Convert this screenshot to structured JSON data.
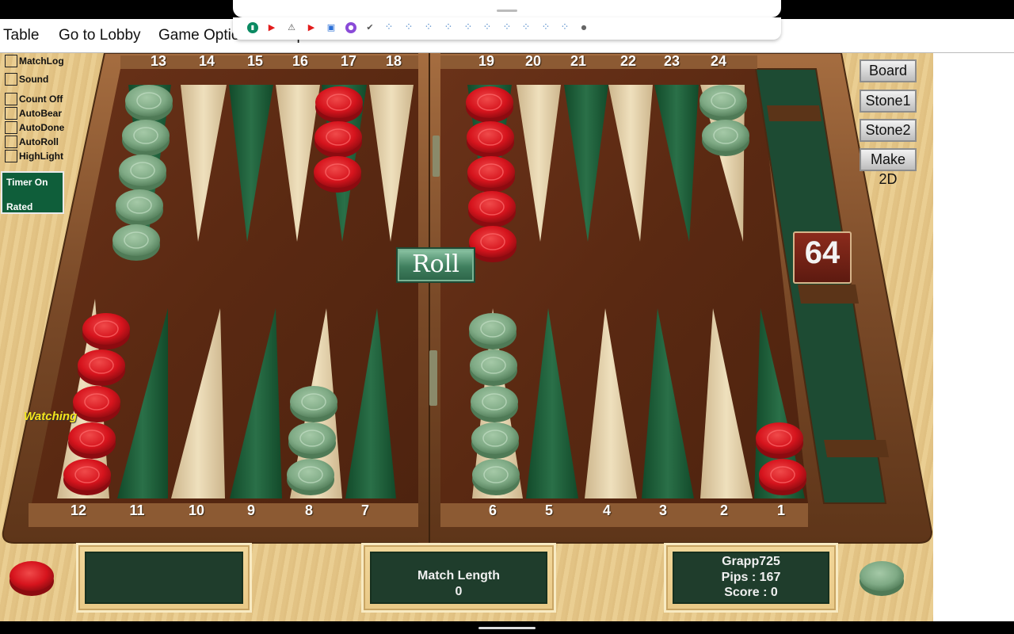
{
  "menu": {
    "items": [
      "Table",
      "Go to Lobby",
      "Game Options",
      "Help"
    ]
  },
  "options": {
    "checkboxes": [
      "MatchLog",
      "Sound",
      "Count Off",
      "AutoBear",
      "AutoDone",
      "AutoRoll",
      "HighLight"
    ],
    "timer": "Timer On",
    "rated": "Rated"
  },
  "status": {
    "watching": "Watching"
  },
  "side_buttons": [
    "Board",
    "Stone1",
    "Stone2",
    "Make 2D"
  ],
  "cube": {
    "value": "64"
  },
  "roll_label": "Roll",
  "board": {
    "top_points": [
      "13",
      "14",
      "15",
      "16",
      "17",
      "18",
      "19",
      "20",
      "21",
      "22",
      "23",
      "24"
    ],
    "bottom_points": [
      "12",
      "11",
      "10",
      "9",
      "8",
      "7",
      "6",
      "5",
      "4",
      "3",
      "2",
      "1"
    ]
  },
  "checkers": {
    "point13": {
      "color": "green",
      "count": 5
    },
    "point17": {
      "color": "red",
      "count": 3
    },
    "point19": {
      "color": "red",
      "count": 5
    },
    "point24": {
      "color": "green",
      "count": 2
    },
    "point12": {
      "color": "red",
      "count": 5
    },
    "point8": {
      "color": "green",
      "count": 3
    },
    "point6": {
      "color": "green",
      "count": 5
    },
    "point1": {
      "color": "red",
      "count": 2
    }
  },
  "match": {
    "label": "Match Length",
    "length": "0"
  },
  "player": {
    "name": "Grapp725",
    "pips": "Pips : 167",
    "score": "Score : 0"
  },
  "colors": {
    "red_checker": "#d8141e",
    "green_checker": "#7fae86",
    "felt": "#5a2a14",
    "dark_point": "#1e5c35",
    "light_point": "#e6d3ac",
    "frame": "#8a5a34"
  }
}
